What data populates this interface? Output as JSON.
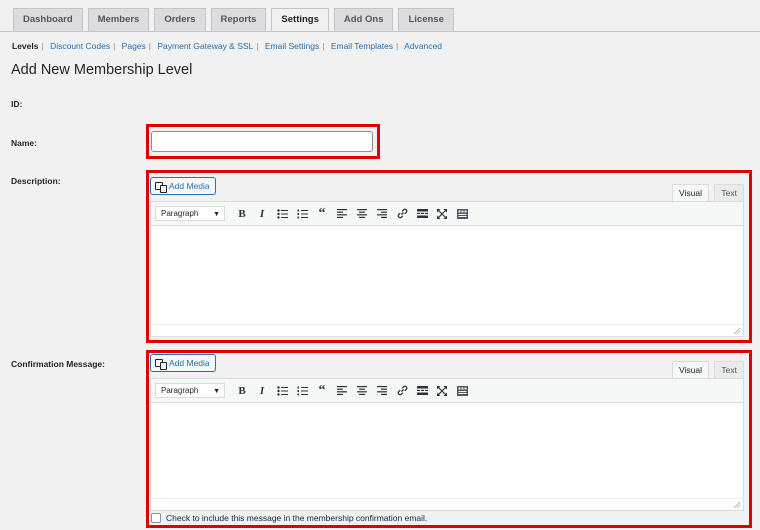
{
  "tabs": [
    {
      "label": "Dashboard"
    },
    {
      "label": "Members"
    },
    {
      "label": "Orders"
    },
    {
      "label": "Reports"
    },
    {
      "label": "Settings",
      "active": true
    },
    {
      "label": "Add Ons"
    },
    {
      "label": "License"
    }
  ],
  "subnav": [
    {
      "label": "Levels",
      "current": true
    },
    {
      "label": "Discount Codes"
    },
    {
      "label": "Pages"
    },
    {
      "label": "Payment Gateway & SSL"
    },
    {
      "label": "Email Settings"
    },
    {
      "label": "Email Templates"
    },
    {
      "label": "Advanced"
    }
  ],
  "page": {
    "title": "Add New Membership Level"
  },
  "form": {
    "id_label": "ID:",
    "name_label": "Name:",
    "name_value": "",
    "description_label": "Description:",
    "confirmation_label": "Confirmation Message:",
    "confirmation_checkbox_label": "Check to include this message in the membership confirmation email."
  },
  "editor": {
    "add_media_label": "Add Media",
    "visual_tab": "Visual",
    "text_tab": "Text",
    "format_select": "Paragraph",
    "toolbar_icons": [
      "bold-icon",
      "italic-icon",
      "bullet-list-icon",
      "numbered-list-icon",
      "blockquote-icon",
      "align-left-icon",
      "align-center-icon",
      "align-right-icon",
      "link-icon",
      "read-more-icon",
      "fullscreen-icon",
      "toolbar-toggle-icon"
    ]
  },
  "colors": {
    "highlight": "#e00000",
    "link": "#2271b1"
  }
}
